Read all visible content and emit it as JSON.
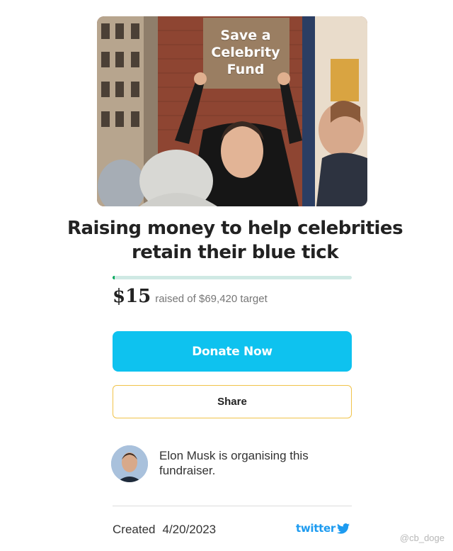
{
  "hero": {
    "sign_text": "Save a\nCelebrity\nFund",
    "alt": "person holding a sign"
  },
  "campaign": {
    "title": "Raising money to help celebrities retain their blue tick",
    "raised_amount": "$15",
    "raised_label": "raised of",
    "target": "$69,420",
    "target_suffix": "target",
    "progress_fraction": 0.0002
  },
  "actions": {
    "donate_label": "Donate Now",
    "share_label": "Share"
  },
  "organiser": {
    "text": "Elon Musk is organising this fundraiser."
  },
  "footer": {
    "created_label": "Created",
    "created_date": "4/20/2023",
    "brand": "twitter"
  },
  "watermark": "@cb_doge",
  "colors": {
    "donate": "#0ec2ef",
    "progress": "#02a95c",
    "share_border": "#f0c34a",
    "twitter": "#1d9bf0"
  }
}
